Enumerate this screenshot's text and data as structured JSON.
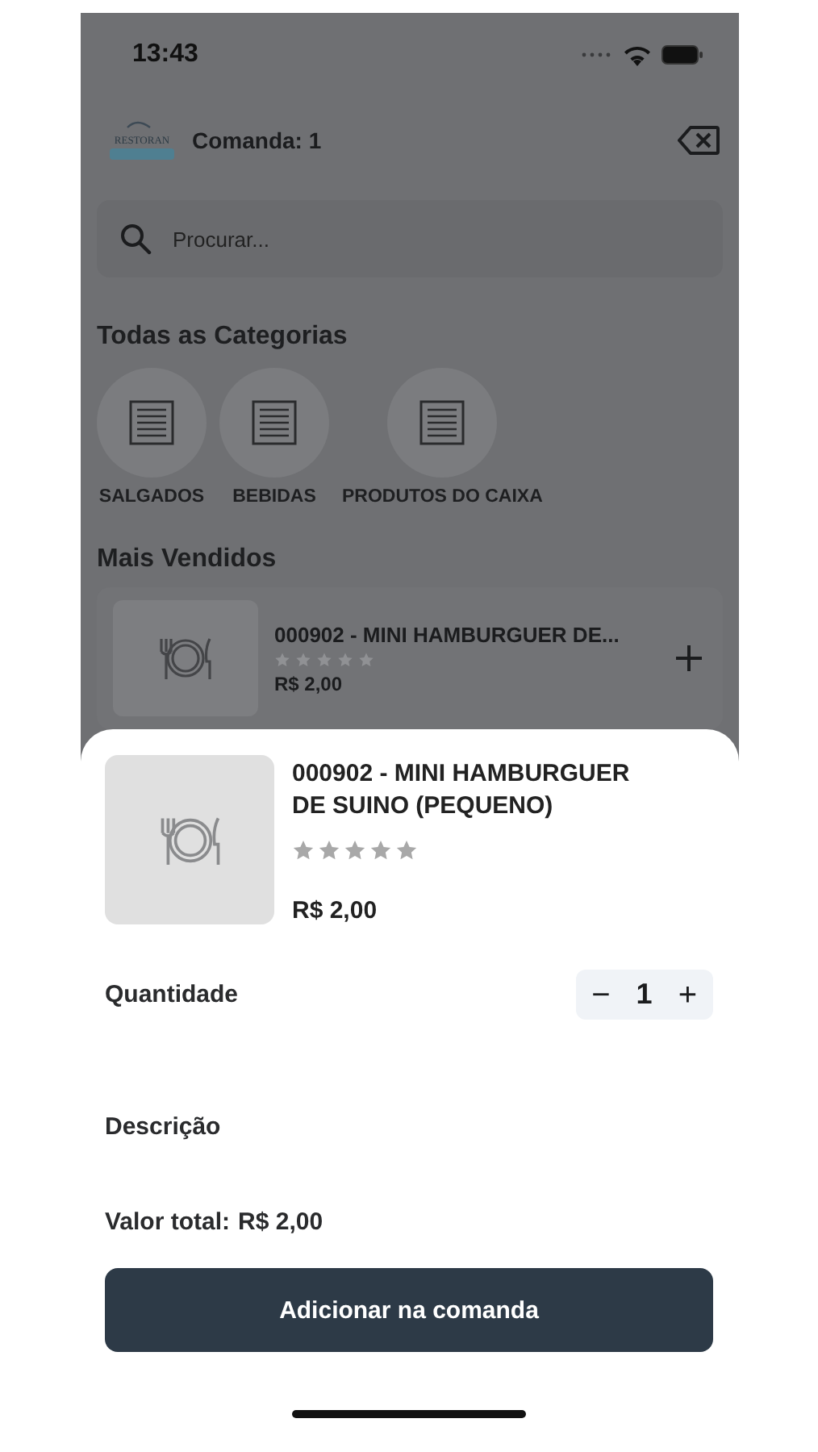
{
  "status_bar": {
    "time": "13:43"
  },
  "header": {
    "logo_text": "RESTORAN",
    "title": "Comanda: 1"
  },
  "search": {
    "placeholder": "Procurar..."
  },
  "categories": {
    "title": "Todas as Categorias",
    "items": [
      {
        "label": "SALGADOS"
      },
      {
        "label": "BEBIDAS"
      },
      {
        "label": "PRODUTOS DO CAIXA"
      }
    ]
  },
  "best_sellers": {
    "title": "Mais Vendidos",
    "items": [
      {
        "name": "000902 - MINI HAMBURGUER DE...",
        "stars": 0,
        "price": "R$ 2,00"
      }
    ]
  },
  "product_sheet": {
    "name": "000902 - MINI HAMBURGUER DE SUINO (PEQUENO)",
    "stars": 0,
    "price": "R$ 2,00",
    "quantity_label": "Quantidade",
    "decrement": "−",
    "quantity": "1",
    "increment": "+",
    "description_label": "Descrição",
    "total_label": "Valor total:",
    "total_value": "R$ 2,00",
    "button": "Adicionar na comanda"
  }
}
